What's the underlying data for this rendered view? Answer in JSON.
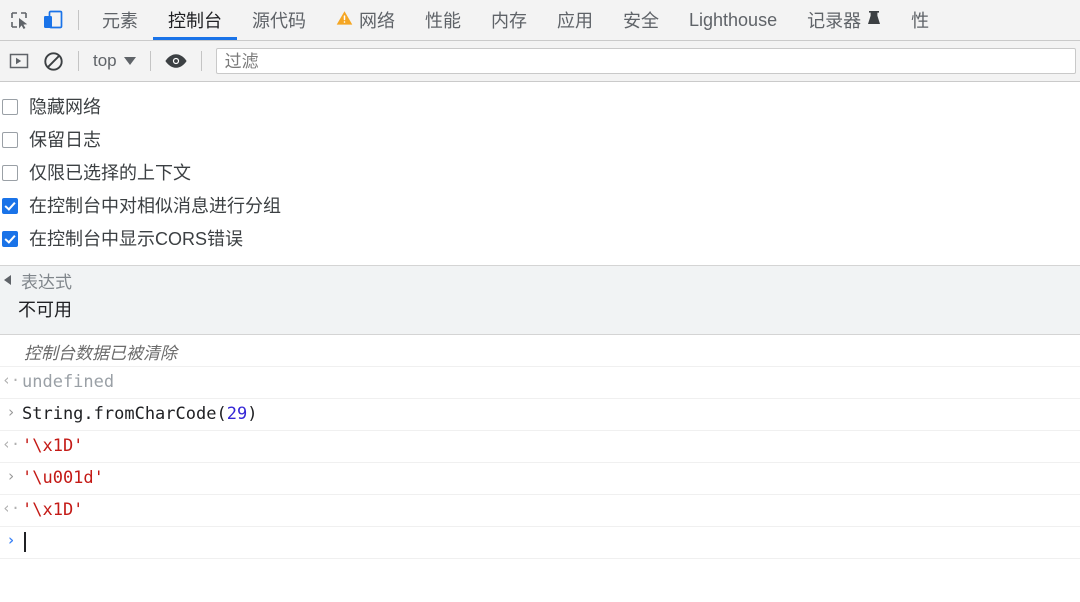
{
  "toolbar": {
    "inspect_icon": "inspect-element-icon",
    "device_icon": "device-toolbar-icon",
    "tabs": [
      {
        "label": "元素",
        "active": false,
        "icon": null
      },
      {
        "label": "控制台",
        "active": true,
        "icon": null
      },
      {
        "label": "源代码",
        "active": false,
        "icon": null
      },
      {
        "label": "网络",
        "active": false,
        "icon": "warning-triangle-icon"
      },
      {
        "label": "性能",
        "active": false,
        "icon": null
      },
      {
        "label": "内存",
        "active": false,
        "icon": null
      },
      {
        "label": "应用",
        "active": false,
        "icon": null
      },
      {
        "label": "安全",
        "active": false,
        "icon": null
      },
      {
        "label": "Lighthouse",
        "active": false,
        "icon": null
      },
      {
        "label": "记录器",
        "active": false,
        "icon": "flask-icon"
      },
      {
        "label": "性",
        "active": false,
        "icon": null
      }
    ]
  },
  "filterbar": {
    "sidebar_toggle_icon": "sidebar-toggle-icon",
    "clear_console_icon": "clear-console-icon",
    "context_value": "top",
    "eye_icon": "live-expression-eye-icon",
    "filter_placeholder": "过滤"
  },
  "settings": [
    {
      "label": "隐藏网络",
      "checked": false
    },
    {
      "label": "保留日志",
      "checked": false
    },
    {
      "label": "仅限已选择的上下文",
      "checked": false
    },
    {
      "label": "在控制台中对相似消息进行分组",
      "checked": true
    },
    {
      "label": "在控制台中显示CORS错误",
      "checked": true
    }
  ],
  "watch": {
    "title": "表达式",
    "body": "不可用"
  },
  "console": {
    "cleared_message": "控制台数据已被清除",
    "rows": [
      {
        "kind": "result",
        "gutter": "‹·",
        "text": "undefined",
        "style": "undef"
      },
      {
        "kind": "input",
        "gutter": "›",
        "text": "String.fromCharCode(29)",
        "style": "code",
        "code_prefix": "String.fromCharCode(",
        "code_number": "29",
        "code_suffix": ")"
      },
      {
        "kind": "result",
        "gutter": "‹·",
        "text": "'\\x1D'",
        "style": "string"
      },
      {
        "kind": "input",
        "gutter": "›",
        "text": "'\\u001d'",
        "style": "string"
      },
      {
        "kind": "result",
        "gutter": "‹·",
        "text": "'\\x1D'",
        "style": "string"
      }
    ],
    "prompt_gutter": "›",
    "prompt_value": ""
  },
  "colors": {
    "accent": "#1a73e8",
    "warning": "#f5a623",
    "string": "#c41a16",
    "number": "#3426d6",
    "muted": "#9aa0a6"
  }
}
